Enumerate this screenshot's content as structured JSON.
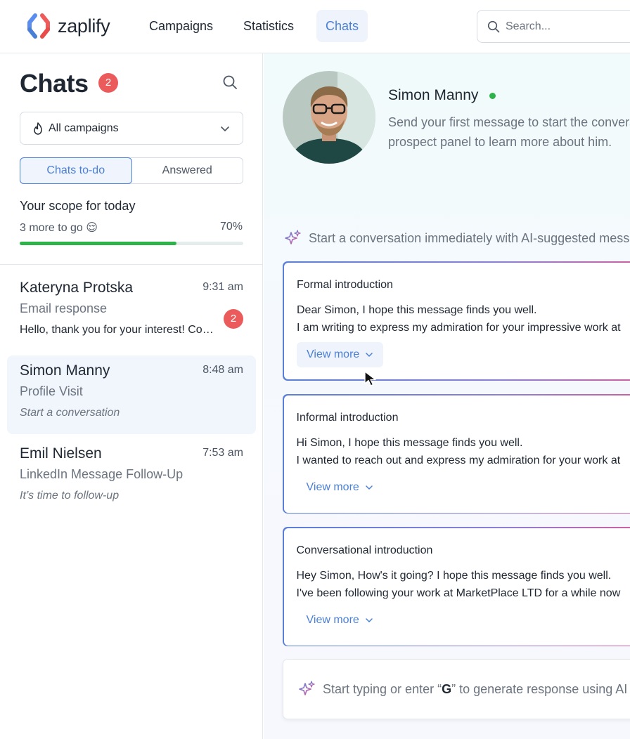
{
  "brand": {
    "name": "zaplify"
  },
  "nav": {
    "items": [
      {
        "label": "Campaigns",
        "active": false
      },
      {
        "label": "Statistics",
        "active": false
      },
      {
        "label": "Chats",
        "active": true
      }
    ],
    "search_placeholder": "Search..."
  },
  "sidebar": {
    "title": "Chats",
    "unread_count": "2",
    "campaign_filter": {
      "selected": "All campaigns",
      "icon": "flame-icon"
    },
    "tabs": [
      {
        "label": "Chats to-do",
        "active": true
      },
      {
        "label": "Answered",
        "active": false
      }
    ],
    "scope": {
      "title": "Your scope for today",
      "remaining": "3 more to go 😌",
      "percent_label": "70%",
      "progress": 0.7
    },
    "chats": [
      {
        "name": "Kateryna Protska",
        "time": "9:31 am",
        "type": "Email response",
        "preview": "Hello, thank you for your interest! Could you share more details",
        "unread": "2",
        "selected": false
      },
      {
        "name": "Simon Manny",
        "time": "8:48 am",
        "type": "Profile Visit",
        "preview": "Start a conversation",
        "unread": null,
        "selected": true
      },
      {
        "name": "Emil Nielsen",
        "time": "7:53 am",
        "type": "LinkedIn Message Follow-Up",
        "preview": "It’s time to follow-up",
        "unread": null,
        "selected": false
      }
    ]
  },
  "conversation": {
    "contact_name": "Simon Manny",
    "online": true,
    "intro_line1": "Send your first message to start the conversation",
    "intro_line2": "prospect panel to learn more about him.",
    "ai_hint": "Start a conversation immediately with AI-suggested messages",
    "suggestions": [
      {
        "title": "Formal introduction",
        "line1": "Dear Simon, I hope this message finds you well.",
        "line2": "I am writing to express my admiration for your impressive work at",
        "action": "View more"
      },
      {
        "title": "Informal introduction",
        "line1": "Hi Simon, I hope this message finds you well.",
        "line2": "I wanted to reach out and express my admiration for your work at",
        "action": "View more"
      },
      {
        "title": "Conversational introduction",
        "line1": "Hey Simon, How's it going? I hope this message finds you well.",
        "line2": "I've been following your work at MarketPlace LTD for a while now",
        "action": "View more"
      }
    ],
    "composer": {
      "prefix": "Start typing or enter “",
      "key": "G",
      "suffix": "” to generate response using AI"
    }
  },
  "colors": {
    "accent": "#4a7fd6",
    "badge": "#ec5b5b",
    "progress": "#2db34a",
    "online": "#2db34a"
  }
}
